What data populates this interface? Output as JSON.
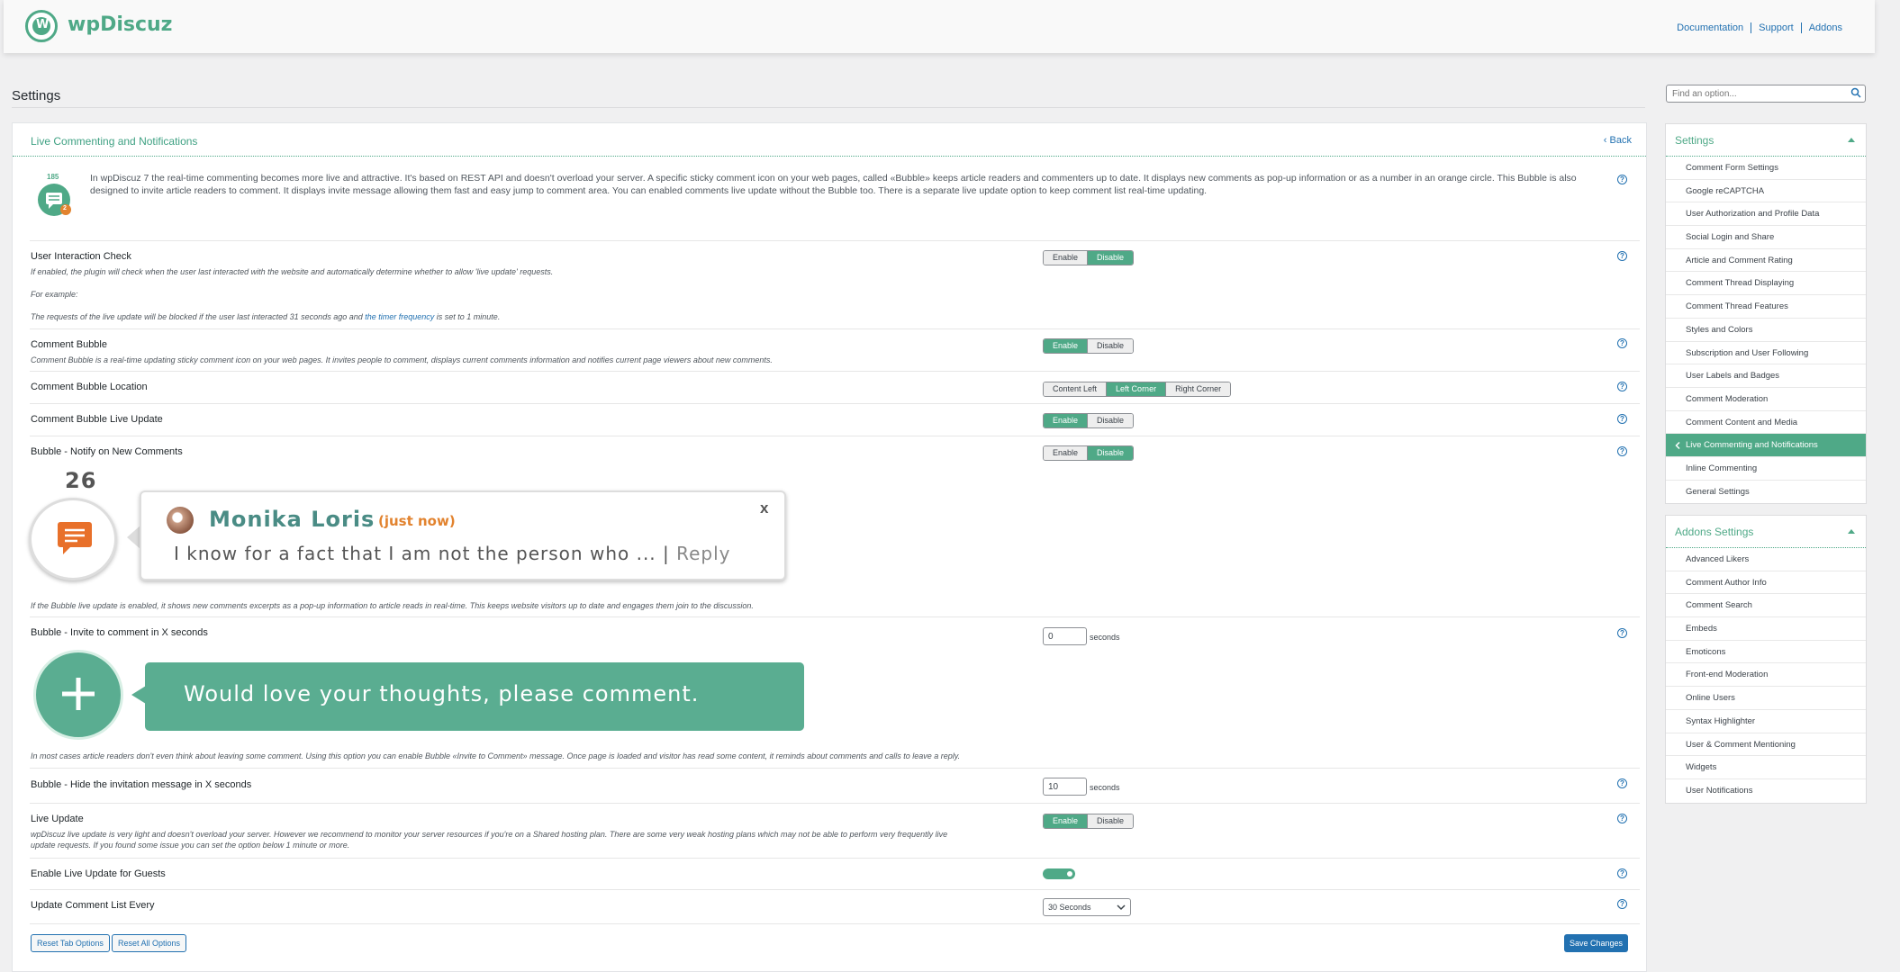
{
  "brand": {
    "name": "wpDiscuz",
    "logo_letter": "W"
  },
  "top_links": [
    "Documentation",
    "Support",
    "Addons"
  ],
  "page": {
    "title": "Settings",
    "search_placeholder": "Find an option..."
  },
  "panel": {
    "title": "Live Commenting and Notifications",
    "back_label": "Back",
    "intro_count": "185",
    "intro_badge": "2",
    "intro": "In wpDiscuz 7 the real-time commenting becomes more live and attractive. It's based on REST API and doesn't overload your server. A specific sticky comment icon on your web pages, called «Bubble» keeps article readers and commenters up to date. It displays new comments as pop-up information or as a number in an orange circle. This Bubble is also designed to invite article readers to comment. It displays invite message allowing them fast and easy jump to comment area. You can enabled comments live update without the Bubble too. There is a separate live update option to keep comment list real-time updating."
  },
  "options": {
    "interaction": {
      "title": "User Interaction Check",
      "desc": "If enabled, the plugin will check when the user last interacted with the website and automatically determine whether to allow 'live update' requests.",
      "example_label": "For example:",
      "example_pre": "The requests of the live update will be blocked if the user last interacted 31 seconds ago and ",
      "example_link": "the timer frequency",
      "example_post": " is set to 1 minute.",
      "enable": "Enable",
      "disable": "Disable",
      "value": "Disable"
    },
    "bubble": {
      "title": "Comment Bubble",
      "desc": "Comment Bubble is a real-time updating sticky comment icon on your web pages. It invites people to comment, displays current comments information and notifies current page viewers about new comments.",
      "enable": "Enable",
      "disable": "Disable",
      "value": "Enable"
    },
    "location": {
      "title": "Comment Bubble Location",
      "opt1": "Content Left",
      "opt2": "Left Corner",
      "opt3": "Right Corner",
      "value": "Left Corner"
    },
    "bubble_live": {
      "title": "Comment Bubble Live Update",
      "enable": "Enable",
      "disable": "Disable",
      "value": "Enable"
    },
    "notify": {
      "title": "Bubble - Notify on New Comments",
      "enable": "Enable",
      "disable": "Disable",
      "value": "Disable",
      "demo_count": "26",
      "demo_name": "Monika Loris",
      "demo_time": "(just now)",
      "demo_close": "x",
      "demo_message": "I know for a fact that I am not the person who ... |",
      "demo_reply": "Reply",
      "desc": "If the Bubble live update is enabled, it shows new comments excerpts as a pop-up information to article reads in real-time. This keeps website visitors up to date and engages them join to the discussion."
    },
    "invite": {
      "title": "Bubble - Invite to comment in X seconds",
      "value": "0",
      "unit": "seconds",
      "demo_text": "Would love your thoughts, please comment.",
      "desc": "In most cases article readers don't even think about leaving some comment. Using this option you can enable Bubble «Invite to Comment» message. Once page is loaded and visitor has read some content, it reminds about comments and calls to leave a reply."
    },
    "hide": {
      "title": "Bubble - Hide the invitation message in X seconds",
      "value": "10",
      "unit": "seconds"
    },
    "live_update": {
      "title": "Live Update",
      "desc_line1": "wpDiscuz live update is very light and doesn't overload your server. However we recommend to monitor your server resources if you're on a Shared hosting plan. There are some very weak hosting plans which may not be able to perform very frequently live",
      "desc_line2": "update requests. If you found some issue you can set the option below 1 minute or more.",
      "enable": "Enable",
      "disable": "Disable",
      "value": "Enable"
    },
    "guests": {
      "title": "Enable Live Update for Guests",
      "value": true
    },
    "frequency": {
      "title": "Update Comment List Every",
      "value": "30 Seconds"
    }
  },
  "buttons": {
    "reset_tab": "Reset Tab Options",
    "reset_all": "Reset All Options",
    "save": "Save Changes"
  },
  "sidebar": {
    "settings_title": "Settings",
    "settings_items": [
      "Comment Form Settings",
      "Google reCAPTCHA",
      "User Authorization and Profile Data",
      "Social Login and Share",
      "Article and Comment Rating",
      "Comment Thread Displaying",
      "Comment Thread Features",
      "Styles and Colors",
      "Subscription and User Following",
      "User Labels and Badges",
      "Comment Moderation",
      "Comment Content and Media",
      "Live Commenting and Notifications",
      "Inline Commenting",
      "General Settings"
    ],
    "addons_title": "Addons Settings",
    "addons_items": [
      "Advanced Likers",
      "Comment Author Info",
      "Comment Search",
      "Embeds",
      "Emoticons",
      "Front-end Moderation",
      "Online Users",
      "Syntax Highlighter",
      "User & Comment Mentioning",
      "Widgets",
      "User Notifications"
    ]
  },
  "colors": {
    "accent": "#4fa987",
    "link": "#2271b1"
  }
}
